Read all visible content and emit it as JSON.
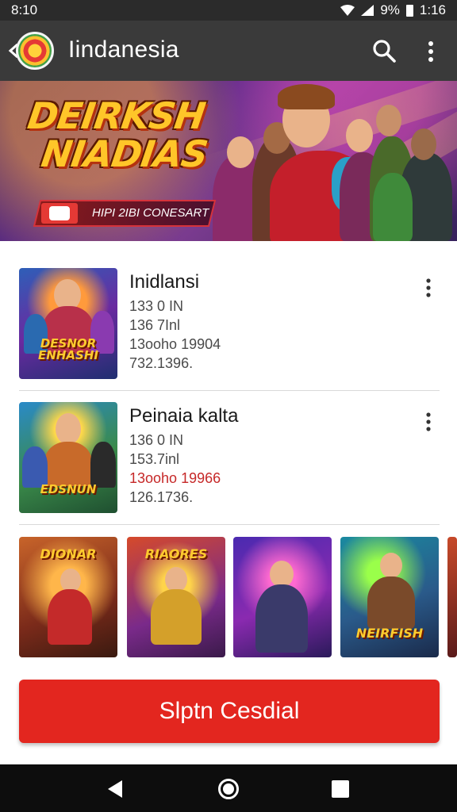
{
  "status_bar": {
    "time": "8:10",
    "battery_percent": "9%",
    "clock_right": "1:16"
  },
  "app_bar": {
    "title": "Iindanesia",
    "icons": [
      "back-icon",
      "app-logo",
      "search-icon",
      "overflow-icon"
    ]
  },
  "banner": {
    "title_line1": "DEIRKSH",
    "title_line2": "NIADIAS",
    "ribbon_text": "HIPI 2IBI CONESART"
  },
  "list": [
    {
      "title": "Inidlansi",
      "lines": [
        "133 0 IN",
        "136 7Inl",
        "13ooho 19904",
        "732.1396."
      ],
      "thumb_label": "DESNOR ENHASHI",
      "colors": {
        "line3": "#4a4a4a"
      }
    },
    {
      "title": "Peinaia kalta",
      "lines": [
        "136 0 IN",
        "153.7inl",
        "13ooho 19966",
        "126.1736."
      ],
      "thumb_label": "EDSNUN",
      "colors": {
        "line3": "#c62828"
      }
    }
  ],
  "carousel": [
    {
      "label": "DIONAR"
    },
    {
      "label": "RIAORES"
    },
    {
      "label": ""
    },
    {
      "label": "NEIRFISH"
    }
  ],
  "action_button": {
    "label": "Slptn Cesdial"
  },
  "nav_bar": {
    "icons": [
      "nav-back-icon",
      "nav-home-icon",
      "nav-recents-icon"
    ]
  },
  "colors": {
    "app_bar": "#3a3a3a",
    "status_bar": "#2b2b2b",
    "accent_red": "#e3261f",
    "banner_title": "#ffc629",
    "nav_bar": "#0d0d0d"
  }
}
